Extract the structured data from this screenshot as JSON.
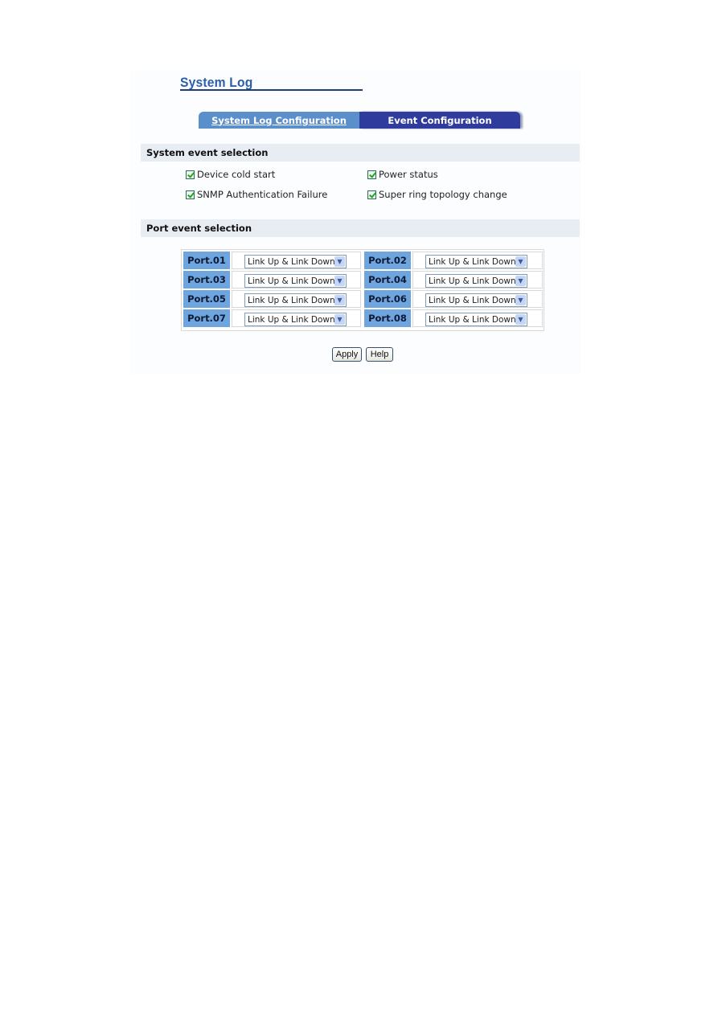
{
  "page": {
    "title": "System Log"
  },
  "tabs": [
    {
      "label": "System Log Configuration",
      "active": false
    },
    {
      "label": "Event Configuration",
      "active": true
    }
  ],
  "system_events": {
    "heading": "System event selection",
    "items": [
      {
        "label": "Device cold start",
        "checked": true
      },
      {
        "label": "Power status",
        "checked": true
      },
      {
        "label": "SNMP Authentication Failure",
        "checked": true
      },
      {
        "label": "Super ring topology change",
        "checked": true
      }
    ]
  },
  "port_events": {
    "heading": "Port event selection",
    "ports": [
      {
        "label": "Port.01",
        "value": "Link Up & Link Down"
      },
      {
        "label": "Port.02",
        "value": "Link Up & Link Down"
      },
      {
        "label": "Port.03",
        "value": "Link Up & Link Down"
      },
      {
        "label": "Port.04",
        "value": "Link Up & Link Down"
      },
      {
        "label": "Port.05",
        "value": "Link Up & Link Down"
      },
      {
        "label": "Port.06",
        "value": "Link Up & Link Down"
      },
      {
        "label": "Port.07",
        "value": "Link Up & Link Down"
      },
      {
        "label": "Port.08",
        "value": "Link Up & Link Down"
      }
    ]
  },
  "buttons": {
    "apply": "Apply",
    "help": "Help"
  },
  "icons": {
    "dropdown": "chevron-down-icon",
    "checkbox": "checkmark-icon"
  },
  "colors": {
    "tab_active": "#2f3c9e",
    "tab_inactive": "#5b8fcc",
    "port_label_bg": "#6ea5de",
    "section_bar": "#e8ecf3",
    "title": "#2b5fa8"
  }
}
